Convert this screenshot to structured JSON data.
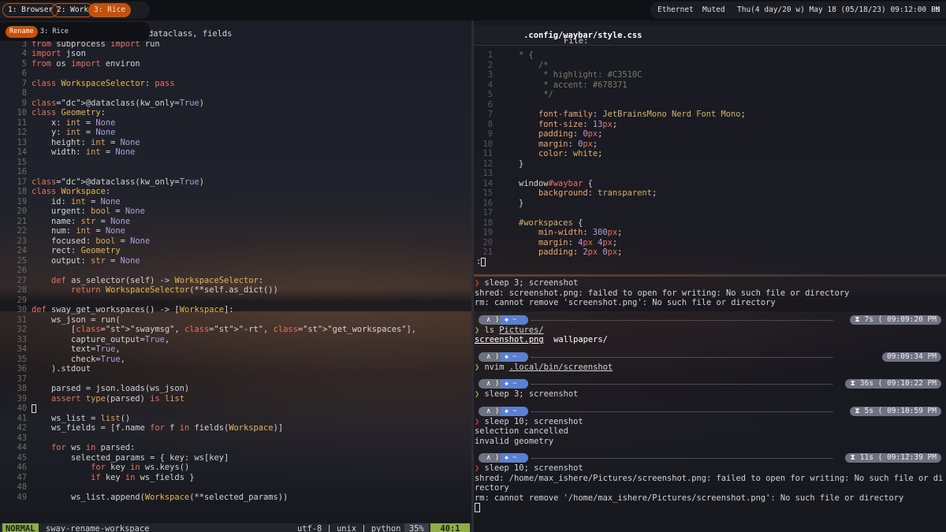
{
  "topbar": {
    "workspaces": [
      {
        "label": "1: Browser",
        "active": false
      },
      {
        "label": "2: Work",
        "active": false
      },
      {
        "label": "3: Rice",
        "active": true
      }
    ],
    "network": "Ethernet",
    "volume": "Muted",
    "clock": "Thu(4 day/20 w) May 18 (05/18/23) 09:12:00 PM",
    "layout": "us"
  },
  "rename_popup": {
    "button": "Rename",
    "label": "3: Rice"
  },
  "editor": {
    "first_line_text": "dataclass, fields",
    "lines": [
      {
        "n": "3",
        "text": "from subprocess import run"
      },
      {
        "n": "4",
        "text": "import json"
      },
      {
        "n": "5",
        "text": "from os import environ"
      },
      {
        "n": "6",
        "text": ""
      },
      {
        "n": "7",
        "text": "class WorkspaceSelector: pass"
      },
      {
        "n": "8",
        "text": ""
      },
      {
        "n": "9",
        "text": "@dataclass(kw_only=True)"
      },
      {
        "n": "10",
        "text": "class Geometry:"
      },
      {
        "n": "11",
        "text": "    x: int = None"
      },
      {
        "n": "12",
        "text": "    y: int = None"
      },
      {
        "n": "13",
        "text": "    height: int = None"
      },
      {
        "n": "14",
        "text": "    width: int = None"
      },
      {
        "n": "15",
        "text": ""
      },
      {
        "n": "16",
        "text": ""
      },
      {
        "n": "17",
        "text": "@dataclass(kw_only=True)"
      },
      {
        "n": "18",
        "text": "class Workspace:"
      },
      {
        "n": "19",
        "text": "    id: int = None"
      },
      {
        "n": "20",
        "text": "    urgent: bool = None"
      },
      {
        "n": "21",
        "text": "    name: str = None"
      },
      {
        "n": "22",
        "text": "    num: int = None"
      },
      {
        "n": "23",
        "text": "    focused: bool = None"
      },
      {
        "n": "24",
        "text": "    rect: Geometry"
      },
      {
        "n": "25",
        "text": "    output: str = None"
      },
      {
        "n": "26",
        "text": ""
      },
      {
        "n": "27",
        "text": "    def as_selector(self) -> WorkspaceSelector:"
      },
      {
        "n": "28",
        "text": "        return WorkspaceSelector(**self.as_dict())"
      },
      {
        "n": "29",
        "text": ""
      },
      {
        "n": "30",
        "text": "def sway_get_workspaces() -> [Workspace]:"
      },
      {
        "n": "31",
        "text": "    ws_json = run("
      },
      {
        "n": "32",
        "text": "        [\"swaymsg\", \"-rt\", \"get_workspaces\"],"
      },
      {
        "n": "33",
        "text": "        capture_output=True,"
      },
      {
        "n": "34",
        "text": "        text=True,"
      },
      {
        "n": "35",
        "text": "        check=True,"
      },
      {
        "n": "36",
        "text": "    ).stdout"
      },
      {
        "n": "37",
        "text": ""
      },
      {
        "n": "38",
        "text": "    parsed = json.loads(ws_json)"
      },
      {
        "n": "39",
        "text": "    assert type(parsed) is list"
      },
      {
        "n": "40",
        "text": ""
      },
      {
        "n": "41",
        "text": "    ws_list = list()"
      },
      {
        "n": "42",
        "text": "    ws_fields = [f.name for f in fields(Workspace)]"
      },
      {
        "n": "43",
        "text": ""
      },
      {
        "n": "44",
        "text": "    for ws in parsed:"
      },
      {
        "n": "45",
        "text": "        selected_params = { key: ws[key]"
      },
      {
        "n": "46",
        "text": "            for key in ws.keys()"
      },
      {
        "n": "47",
        "text": "            if key in ws_fields }"
      },
      {
        "n": "48",
        "text": ""
      },
      {
        "n": "49",
        "text": "        ws_list.append(Workspace(**selected_params))"
      }
    ],
    "status": {
      "mode": "NORMAL",
      "filename": "sway-rename-workspace",
      "info": "utf-8 | unix | python",
      "percent": "35%",
      "position": "40:1"
    }
  },
  "style_editor": {
    "file_label": "File:",
    "file_path": ".config/waybar/style.css",
    "lines": [
      {
        "n": "1",
        "text": "* {"
      },
      {
        "n": "2",
        "text": "    /*"
      },
      {
        "n": "3",
        "text": "     * highlight: #C3510C"
      },
      {
        "n": "4",
        "text": "     * accent: #678371"
      },
      {
        "n": "5",
        "text": "     */"
      },
      {
        "n": "6",
        "text": ""
      },
      {
        "n": "7",
        "text": "    font-family: JetBrainsMono Nerd Font Mono;"
      },
      {
        "n": "8",
        "text": "    font-size: 13px;"
      },
      {
        "n": "9",
        "text": "    padding: 0px;"
      },
      {
        "n": "10",
        "text": "    margin: 0px;"
      },
      {
        "n": "11",
        "text": "    color: white;"
      },
      {
        "n": "12",
        "text": "}"
      },
      {
        "n": "13",
        "text": ""
      },
      {
        "n": "14",
        "text": "window#waybar {"
      },
      {
        "n": "15",
        "text": "    background: transparent;"
      },
      {
        "n": "16",
        "text": "}"
      },
      {
        "n": "17",
        "text": ""
      },
      {
        "n": "18",
        "text": "#workspaces {"
      },
      {
        "n": "19",
        "text": "    min-width: 300px;"
      },
      {
        "n": "20",
        "text": "    margin: 4px 4px;"
      },
      {
        "n": "21",
        "text": "    padding: 2px 0px;"
      }
    ],
    "cmdline": ":"
  },
  "terminal": {
    "prompt_arrows": "∧ ) ◆ ~",
    "blocks": [
      {
        "cmd": "sleep 3; screenshot",
        "ok": false,
        "output": [
          "shred: screenshot.png: failed to open for writing: No such file or directory",
          "rm: cannot remove 'screenshot.png': No such file or directory"
        ]
      },
      {
        "duration": "⧗ 7s ( 09:09:20 PM",
        "cmd": "ls Pictures/",
        "ok": true,
        "output_ls": [
          "screenshot.png",
          "wallpapers/"
        ]
      },
      {
        "duration": "09:09:34 PM",
        "cmd": "nvim .local/bin/screenshot",
        "ok": true
      },
      {
        "duration": "⧗ 36s ( 09:10:22 PM",
        "cmd": "sleep 3; screenshot",
        "ok": true
      },
      {
        "duration": "⧗ 5s ( 09:10:59 PM",
        "cmd": "sleep 10; screenshot",
        "ok": false,
        "output": [
          "selection cancelled",
          "invalid geometry"
        ]
      },
      {
        "duration": "⧗ 11s ( 09:12:39 PM",
        "cmd": "sleep 10; screenshot",
        "ok": false,
        "output": [
          "shred: /home/max_ishere/Pictures/screenshot.png: failed to open for writing: No such file or di",
          "rectory",
          "rm: cannot remove '/home/max_ishere/Pictures/screenshot.png': No such file or directory"
        ]
      }
    ],
    "colors": {
      "error_chevron": "#d33a2c",
      "ok_chevron": "#8dae45",
      "highlight": "#c3510c"
    }
  }
}
